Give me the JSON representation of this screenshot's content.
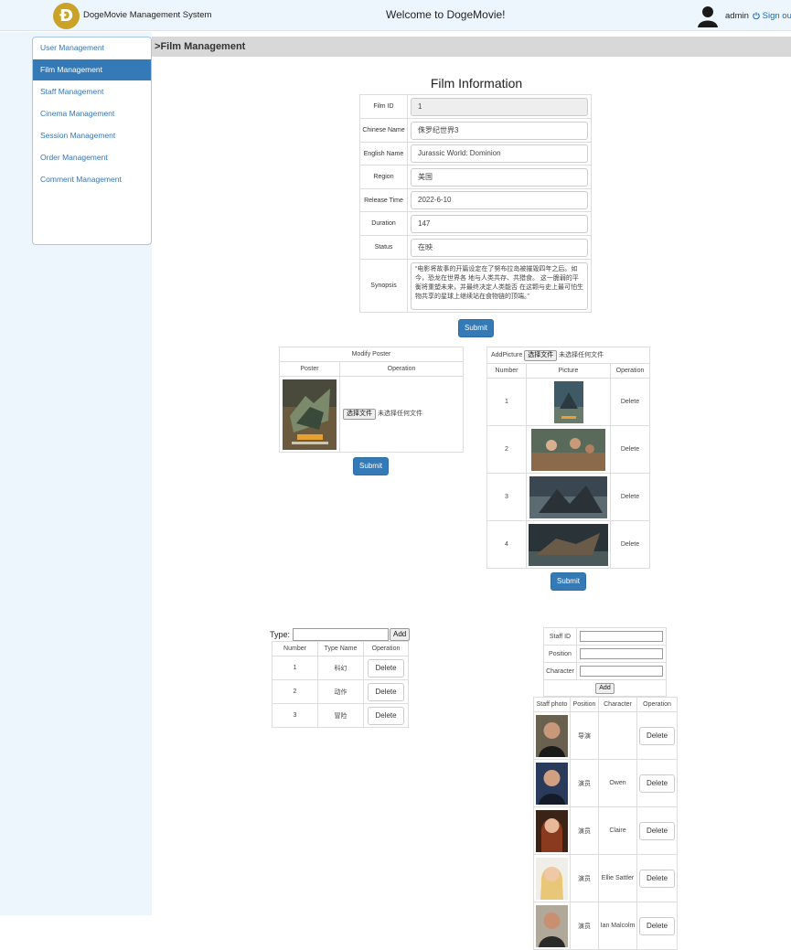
{
  "header": {
    "logo_glyph": "Ð",
    "system_name": "DogeMovie Management System",
    "welcome": "Welcome to DogeMovie!",
    "username": "admin",
    "signout": "Sign out",
    "signout_icon": "power-icon"
  },
  "sidebar": {
    "items": [
      {
        "label": "User Management"
      },
      {
        "label": "Film Management",
        "active": true
      },
      {
        "label": "Staff Management"
      },
      {
        "label": "Cinema Management"
      },
      {
        "label": "Session Management"
      },
      {
        "label": "Order Management"
      },
      {
        "label": "Comment Management"
      }
    ]
  },
  "breadcrumb": {
    "arrow": ">",
    "label": "Film Management"
  },
  "film": {
    "title": "Film Information",
    "fields": [
      {
        "label": "Film ID",
        "value": "1"
      },
      {
        "label": "Chinese Name",
        "value": "侏罗纪世界3"
      },
      {
        "label": "English Name",
        "value": "Jurassic World: Dominion"
      },
      {
        "label": "Region",
        "value": "美国"
      },
      {
        "label": "Release Time",
        "value": "2022-6-10"
      },
      {
        "label": "Duration",
        "value": "147"
      },
      {
        "label": "Status",
        "value": "在映"
      },
      {
        "label": "Synopsis",
        "value": "“电影将故事的开篇设定在了努布拉岛被摧毁四年之后。如今，恐龙在世界各 地与人类共存、共猎食。 这一脆弱的平衡将重塑未来，并最终决定人类能否 在这颗与史上最可怕生物共享的星球上继续站在食物链的顶端。”"
      }
    ],
    "submit": "Submit"
  },
  "poster": {
    "title": "Modify Poster",
    "col_poster": "Poster",
    "col_operation": "Operation",
    "choose_file": "选择文件",
    "no_file": "未选择任何文件",
    "submit": "Submit"
  },
  "pictures": {
    "add_label": "AddPicture",
    "choose_file": "选择文件",
    "no_file": "未选择任何文件",
    "col_number": "Number",
    "col_picture": "Picture",
    "col_operation": "Operation",
    "rows": [
      {
        "number": "1",
        "action": "Delete"
      },
      {
        "number": "2",
        "action": "Delete"
      },
      {
        "number": "3",
        "action": "Delete"
      },
      {
        "number": "4",
        "action": "Delete"
      }
    ],
    "submit": "Submit"
  },
  "types": {
    "label": "Type:",
    "input_value": "",
    "add": "Add",
    "col_number": "Number",
    "col_name": "Type Name",
    "col_operation": "Operation",
    "rows": [
      {
        "number": "1",
        "name": "科幻",
        "action": "Delete"
      },
      {
        "number": "2",
        "name": "动作",
        "action": "Delete"
      },
      {
        "number": "3",
        "name": "冒险",
        "action": "Delete"
      }
    ]
  },
  "staff": {
    "form": {
      "staff_id_label": "Staff ID",
      "position_label": "Position",
      "character_label": "Character",
      "staff_id_value": "",
      "position_value": "",
      "character_value": "",
      "add": "Add"
    },
    "col_photo": "Staff photo",
    "col_position": "Position",
    "col_character": "Character",
    "col_operation": "Operation",
    "rows": [
      {
        "position": "导演",
        "character": "",
        "action": "Delete"
      },
      {
        "position": "演员",
        "character": "Owen",
        "action": "Delete"
      },
      {
        "position": "演员",
        "character": "Claire",
        "action": "Delete"
      },
      {
        "position": "演员",
        "character": "Ellie Sattler",
        "action": "Delete"
      },
      {
        "position": "演员",
        "character": "Ian Malcolm",
        "action": "Delete"
      }
    ]
  },
  "colors": {
    "primary": "#337ab7",
    "header_bg": "#eef6fd",
    "breadcrumb_bg": "#d8d8d8",
    "logo": "#c9a227"
  }
}
